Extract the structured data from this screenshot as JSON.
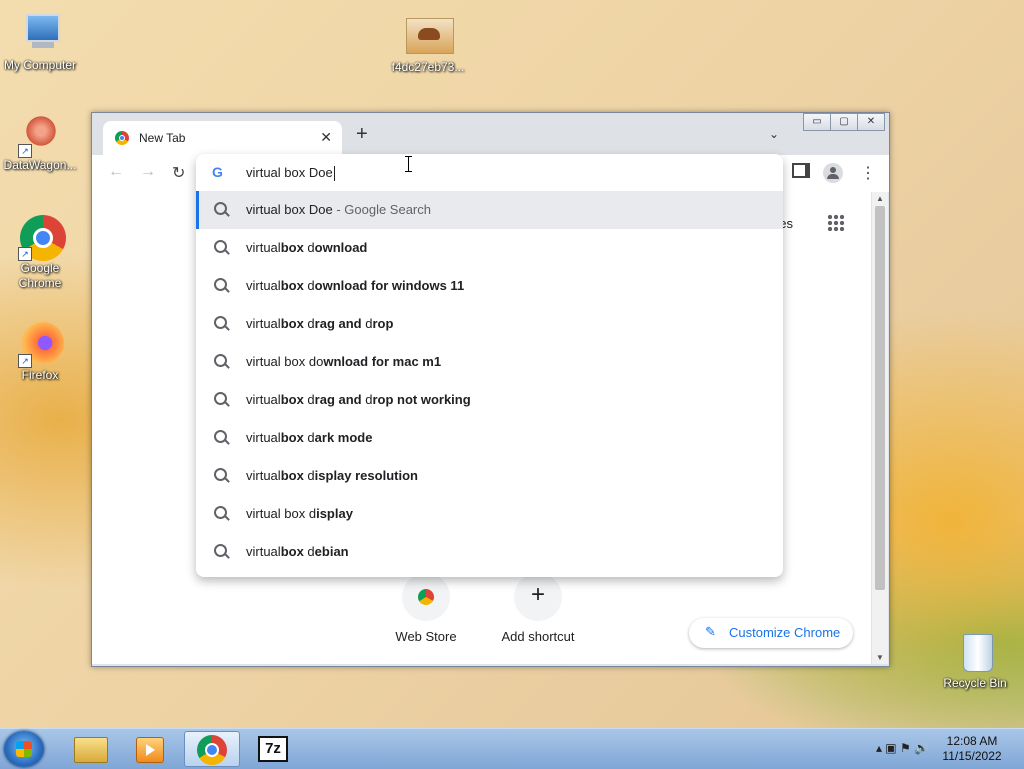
{
  "desktop": {
    "icons": [
      {
        "label": "My Computer"
      },
      {
        "label": "DataWagon..."
      },
      {
        "label": "Google Chrome"
      },
      {
        "label": "Firefox"
      },
      {
        "label": "f4dc27eb73..."
      },
      {
        "label": "Recycle Bin"
      }
    ]
  },
  "browser": {
    "tab_title": "New Tab",
    "tab_close": "✕",
    "new_tab": "+",
    "tab_search": "⌄",
    "window_controls": {
      "minimize": "▭",
      "maximize": "▢",
      "close": "✕"
    },
    "nav": {
      "back": "←",
      "forward": "→",
      "reload": "↻"
    },
    "omnibox_value": "virtual box Doe",
    "suggestions": [
      {
        "parts": [
          {
            "t": "virtual box Doe",
            "b": false
          }
        ],
        "desc": " - Google Search"
      },
      {
        "parts": [
          {
            "t": "virtual",
            "b": false
          },
          {
            "t": "box",
            "b": true
          },
          {
            "t": " d",
            "b": false
          },
          {
            "t": "ownload",
            "b": true
          }
        ]
      },
      {
        "parts": [
          {
            "t": "virtual",
            "b": false
          },
          {
            "t": "box",
            "b": true
          },
          {
            "t": " d",
            "b": false
          },
          {
            "t": "ownload for windows 11",
            "b": true
          }
        ]
      },
      {
        "parts": [
          {
            "t": "virtual",
            "b": false
          },
          {
            "t": "box",
            "b": true
          },
          {
            "t": " d",
            "b": false
          },
          {
            "t": "rag and ",
            "b": true
          },
          {
            "t": "d",
            "b": false
          },
          {
            "t": "rop",
            "b": true
          }
        ]
      },
      {
        "parts": [
          {
            "t": "virtual box do",
            "b": false
          },
          {
            "t": "wnload for mac m1",
            "b": true
          }
        ]
      },
      {
        "parts": [
          {
            "t": "virtual",
            "b": false
          },
          {
            "t": "box",
            "b": true
          },
          {
            "t": " d",
            "b": false
          },
          {
            "t": "rag and ",
            "b": true
          },
          {
            "t": "d",
            "b": false
          },
          {
            "t": "rop not working",
            "b": true
          }
        ]
      },
      {
        "parts": [
          {
            "t": "virtual",
            "b": false
          },
          {
            "t": "box",
            "b": true
          },
          {
            "t": " d",
            "b": false
          },
          {
            "t": "ark mode",
            "b": true
          }
        ]
      },
      {
        "parts": [
          {
            "t": "virtual",
            "b": false
          },
          {
            "t": "box",
            "b": true
          },
          {
            "t": " d",
            "b": false
          },
          {
            "t": "isplay resolution",
            "b": true
          }
        ]
      },
      {
        "parts": [
          {
            "t": "virtual box d",
            "b": false
          },
          {
            "t": "isplay",
            "b": true
          }
        ]
      },
      {
        "parts": [
          {
            "t": "virtual",
            "b": false
          },
          {
            "t": "box",
            "b": true
          },
          {
            "t": " d",
            "b": false
          },
          {
            "t": "ebian",
            "b": true
          }
        ]
      }
    ],
    "page": {
      "images_link": "ges",
      "shortcuts": [
        {
          "label": "Web Store"
        },
        {
          "label": "Add shortcut",
          "icon": "+"
        }
      ],
      "customize_label": "Customize Chrome"
    }
  },
  "taskbar": {
    "clock_time": "12:08 AM",
    "clock_date": "11/15/2022",
    "tray_glyphs": "▴  ▣  ⚑  🔊"
  }
}
